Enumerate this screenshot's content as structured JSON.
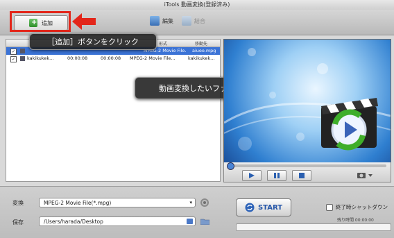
{
  "window": {
    "title": "iTools 動画変換(登録済み)"
  },
  "toolbar": {
    "add_label": "追加",
    "edit_label": "編集",
    "merge_label": "結合"
  },
  "list": {
    "columns": [
      "形式",
      "移動先"
    ],
    "rows": [
      {
        "name": "",
        "duration": "",
        "end": "",
        "format": "MPEG-2 Movie File... ▾",
        "dest": "aiueo.mpg",
        "selected": true
      },
      {
        "name": "kakikukek...",
        "duration": "00:00:08",
        "end": "00:00:08",
        "format": "MPEG-2 Movie File...",
        "dest": "kakikukek...",
        "selected": false
      }
    ]
  },
  "callouts": {
    "add": "［追加］ボタンをクリック",
    "file": "動画変換したいファイルを追加"
  },
  "settings": {
    "convert_label": "変換",
    "convert_value": "MPEG-2 Movie File(*.mpg)",
    "save_label": "保存",
    "save_value": "/Users/harada/Desktop",
    "start_label": "START",
    "shutdown_label": "終了時シャットダウン",
    "remaining_label": "残り時間 00:00:00"
  },
  "colors": {
    "highlight": "#e3261a",
    "selection": "#3b73d6",
    "start_text": "#2455a8"
  }
}
